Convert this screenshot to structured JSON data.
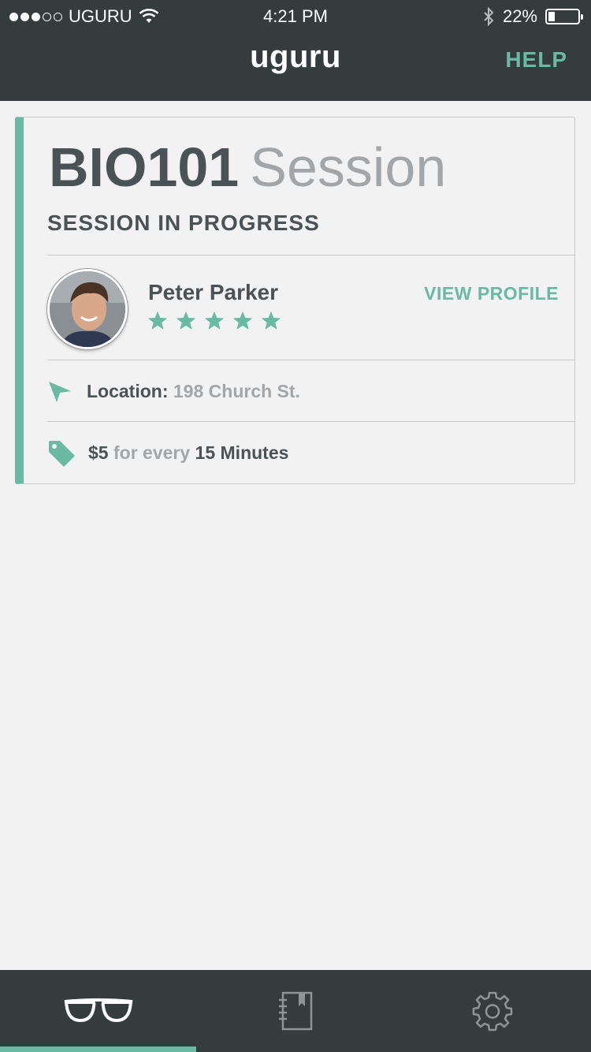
{
  "status_bar": {
    "carrier": "UGURU",
    "signal_bars": [
      true,
      true,
      true,
      false,
      false
    ],
    "time": "4:21 PM",
    "battery_percent": "22%",
    "battery_level": 0.22,
    "icons": [
      "wifi-icon",
      "bluetooth-icon",
      "battery-icon"
    ]
  },
  "header": {
    "brand": "uguru",
    "help_label": "HELP"
  },
  "session": {
    "course_code": "BIO101",
    "course_word": "Session",
    "status": "SESSION IN PROGRESS",
    "tutor": {
      "name": "Peter Parker",
      "rating": 5,
      "rating_max": 5,
      "view_profile_label": "VIEW PROFILE"
    },
    "location_label": "Location:",
    "location_value": "198 Church St.",
    "price": "$5",
    "price_connector": "for every",
    "price_interval": "15 Minutes"
  },
  "tabs": [
    {
      "icon": "glasses-icon",
      "active": true
    },
    {
      "icon": "notebook-icon",
      "active": false
    },
    {
      "icon": "gear-icon",
      "active": false
    }
  ],
  "colors": {
    "accent": "#69b9a3",
    "bar": "#353c3e",
    "background": "#f2f2f2",
    "text_dark": "#4b5256",
    "text_muted": "#a3a6a8"
  }
}
